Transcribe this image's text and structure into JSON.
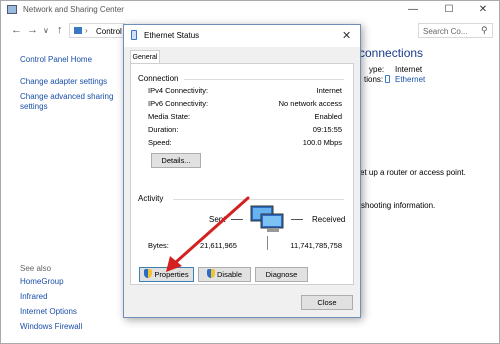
{
  "background_window": {
    "title": "Network and Sharing Center",
    "address": "Control",
    "search_placeholder": "Search Co...",
    "sidebar": {
      "home": "Control Panel Home",
      "links": [
        "Change adapter settings",
        "Change advanced sharing settings"
      ],
      "see_also_label": "See also",
      "see_also": [
        "HomeGroup",
        "Infrared",
        "Internet Options",
        "Windows Firewall"
      ]
    },
    "main": {
      "heading_partial": "connections",
      "access_type_label": "ype:",
      "access_type_value": "Internet",
      "connections_label": "tions:",
      "connections_value": "Ethernet",
      "setup_text": "et up a router or access point.",
      "troubleshoot_text": "shooting information."
    }
  },
  "dialog": {
    "title": "Ethernet Status",
    "tab": "General",
    "connection": {
      "label": "Connection",
      "rows": [
        {
          "label": "IPv4 Connectivity:",
          "value": "Internet"
        },
        {
          "label": "IPv6 Connectivity:",
          "value": "No network access"
        },
        {
          "label": "Media State:",
          "value": "Enabled"
        },
        {
          "label": "Duration:",
          "value": "09:15:55"
        },
        {
          "label": "Speed:",
          "value": "100.0 Mbps"
        }
      ],
      "details_button": "Details..."
    },
    "activity": {
      "label": "Activity",
      "sent_label": "Sent",
      "received_label": "Received",
      "bytes_label": "Bytes:",
      "bytes_sent": "21,611,965",
      "bytes_received": "11,741,785,758"
    },
    "buttons": {
      "properties": "Properties",
      "disable": "Disable",
      "diagnose": "Diagnose",
      "close": "Close"
    }
  },
  "colors": {
    "link": "#1a4fa8",
    "annotation_arrow": "#d42020",
    "dialog_border": "#6f8fb6"
  }
}
